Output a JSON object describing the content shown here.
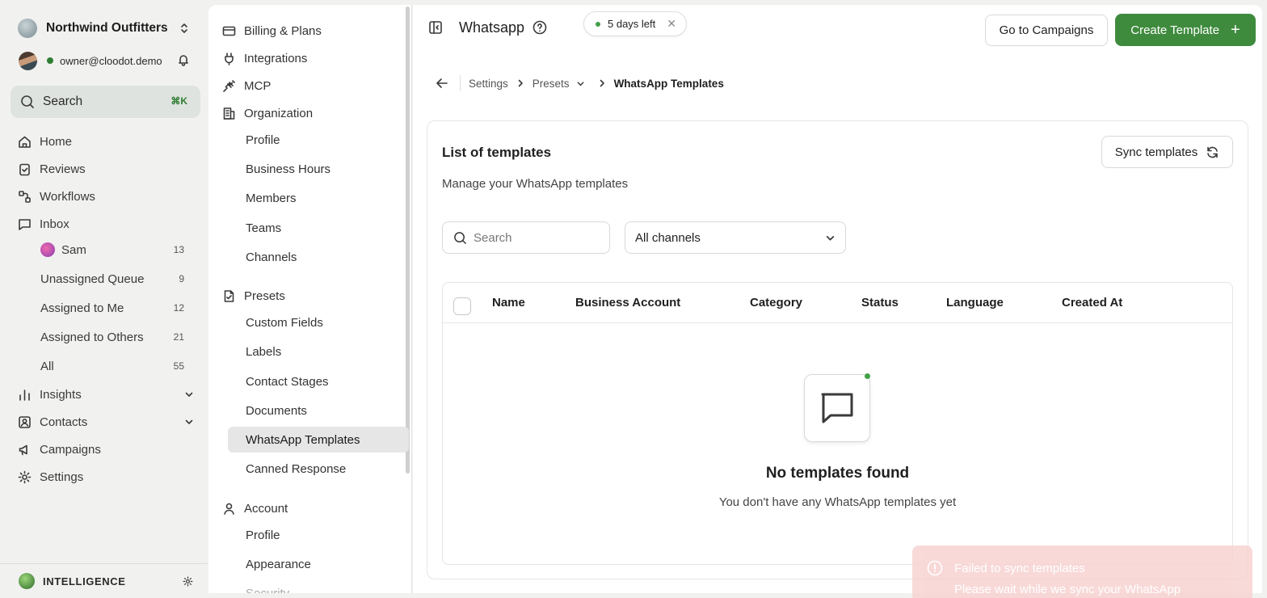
{
  "sidebar": {
    "workspace": "Northwind Outfitters",
    "user_email": "owner@cloodot.demo",
    "search_label": "Search",
    "search_shortcut": "⌘K",
    "nav": {
      "home": "Home",
      "reviews": "Reviews",
      "workflows": "Workflows",
      "inbox": "Inbox",
      "insights": "Insights",
      "contacts": "Contacts",
      "campaigns": "Campaigns",
      "settings": "Settings"
    },
    "inbox_items": [
      {
        "label": "Sam",
        "count": "13"
      },
      {
        "label": "Unassigned Queue",
        "count": "9"
      },
      {
        "label": "Assigned to Me",
        "count": "12"
      },
      {
        "label": "Assigned to Others",
        "count": "21"
      },
      {
        "label": "All",
        "count": "55"
      }
    ],
    "footer": "INTELLIGENCE"
  },
  "settings_nav": {
    "billing": "Billing & Plans",
    "integrations": "Integrations",
    "mcp": "MCP",
    "organization": "Organization",
    "org_items": [
      "Profile",
      "Business Hours",
      "Members",
      "Teams",
      "Channels"
    ],
    "presets": "Presets",
    "preset_items": [
      "Custom Fields",
      "Labels",
      "Contact Stages",
      "Documents",
      "WhatsApp Templates",
      "Canned Response"
    ],
    "account": "Account",
    "account_items": [
      "Profile",
      "Appearance",
      "Security"
    ]
  },
  "header": {
    "title": "Whatsapp",
    "trial_badge": "5 days left",
    "go_campaigns": "Go to Campaigns",
    "create_template": "Create Template"
  },
  "breadcrumb": {
    "items": [
      "Settings",
      "Presets"
    ],
    "current": "WhatsApp Templates"
  },
  "card": {
    "title": "List of templates",
    "subtitle": "Manage your WhatsApp templates",
    "sync_button": "Sync templates",
    "search_placeholder": "Search",
    "channel_filter": "All channels",
    "columns": [
      "Name",
      "Business Account",
      "Category",
      "Status",
      "Language",
      "Created At"
    ],
    "empty_title": "No templates found",
    "empty_subtitle": "You don't have any WhatsApp templates yet"
  },
  "toast": {
    "title": "Failed to sync templates",
    "message": "Please wait while we sync your WhatsApp"
  },
  "colors": {
    "accent": "#3f8b3e",
    "status_online": "#2e7d32",
    "toast_error": "#f7d3d2"
  }
}
